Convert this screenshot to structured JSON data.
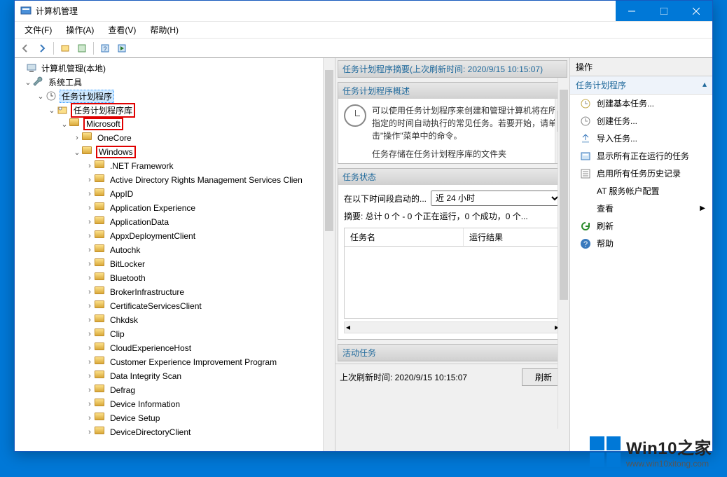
{
  "titlebar": {
    "title": "计算机管理"
  },
  "menubar": {
    "file": "文件(F)",
    "action": "操作(A)",
    "view": "查看(V)",
    "help": "帮助(H)"
  },
  "tree": {
    "root": "计算机管理(本地)",
    "systemTools": "系统工具",
    "taskScheduler": "任务计划程序",
    "taskSchedulerLib": "任务计划程序库",
    "microsoft": "Microsoft",
    "onecore": "OneCore",
    "windows": "Windows",
    "items": [
      ".NET Framework",
      "Active Directory Rights Management Services Clien",
      "AppID",
      "Application Experience",
      "ApplicationData",
      "AppxDeploymentClient",
      "Autochk",
      "BitLocker",
      "Bluetooth",
      "BrokerInfrastructure",
      "CertificateServicesClient",
      "Chkdsk",
      "Clip",
      "CloudExperienceHost",
      "Customer Experience Improvement Program",
      "Data Integrity Scan",
      "Defrag",
      "Device Information",
      "Device Setup",
      "DeviceDirectoryClient"
    ]
  },
  "middle": {
    "summaryHeader": "任务计划程序摘要(上次刷新时间: 2020/9/15 10:15:07)",
    "overviewHeader": "任务计划程序概述",
    "overviewText": "可以使用任务计划程序来创建和管理计算机将在所指定的时间自动执行的常见任务。若要开始，请单击\"操作\"菜单中的命令。",
    "overviewText2": "任务存储在任务计划程序库的文件夹",
    "statusHeader": "任务状态",
    "statusLabel": "在以下时间段启动的...",
    "statusSelect": "近 24 小时",
    "statusSummary": "摘要: 总计 0 个 - 0 个正在运行，0 个成功，0 个...",
    "colTaskName": "任务名",
    "colResult": "运行结果",
    "activeHeader": "活动任务",
    "lastRefresh": "上次刷新时间: 2020/9/15 10:15:07",
    "refreshBtn": "刷新"
  },
  "actions": {
    "paneTitle": "操作",
    "groupTitle": "任务计划程序",
    "items": [
      "创建基本任务...",
      "创建任务...",
      "导入任务...",
      "显示所有正在运行的任务",
      "启用所有任务历史记录",
      "AT 服务帐户配置",
      "查看",
      "刷新",
      "帮助"
    ]
  },
  "watermark": {
    "title": "Win10之家",
    "url": "www.win10xitong.com"
  }
}
